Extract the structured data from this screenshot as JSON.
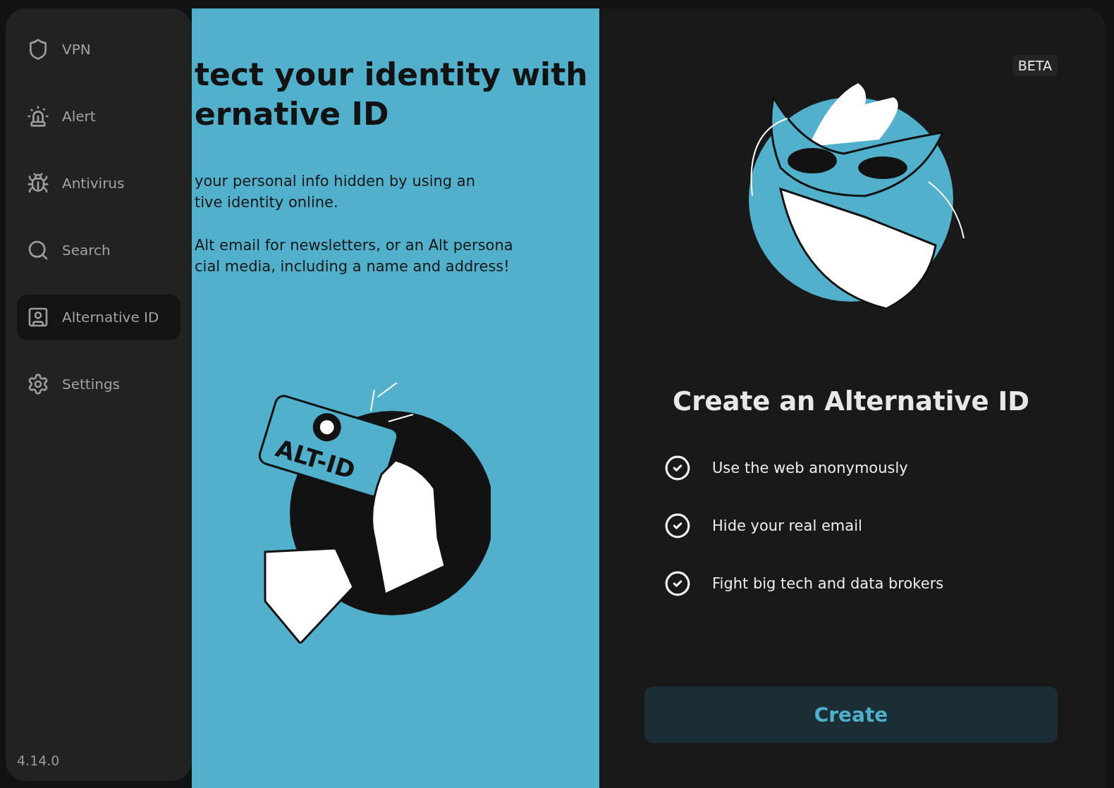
{
  "sidebar": {
    "items": [
      {
        "label": "VPN",
        "selected": false
      },
      {
        "label": "Alert",
        "selected": false
      },
      {
        "label": "Antivirus",
        "selected": false
      },
      {
        "label": "Search",
        "selected": false
      },
      {
        "label": "Alternative ID",
        "selected": true
      },
      {
        "label": "Settings",
        "selected": false
      }
    ],
    "version": "4.14.0"
  },
  "intro": {
    "heading_lines": [
      "tect your identity with",
      "ernative ID"
    ],
    "paragraphs": [
      [
        "your personal info hidden by using an",
        "tive identity online."
      ],
      [
        "Alt email for newsletters, or an Alt persona",
        "cial media, including a name and address!"
      ]
    ],
    "card_label": "ALT-ID"
  },
  "panel": {
    "badge": "BETA",
    "title": "Create an Alternative ID",
    "features": [
      "Use the web anonymously",
      "Hide your real email",
      "Fight big tech and data brokers"
    ],
    "button": "Create"
  }
}
